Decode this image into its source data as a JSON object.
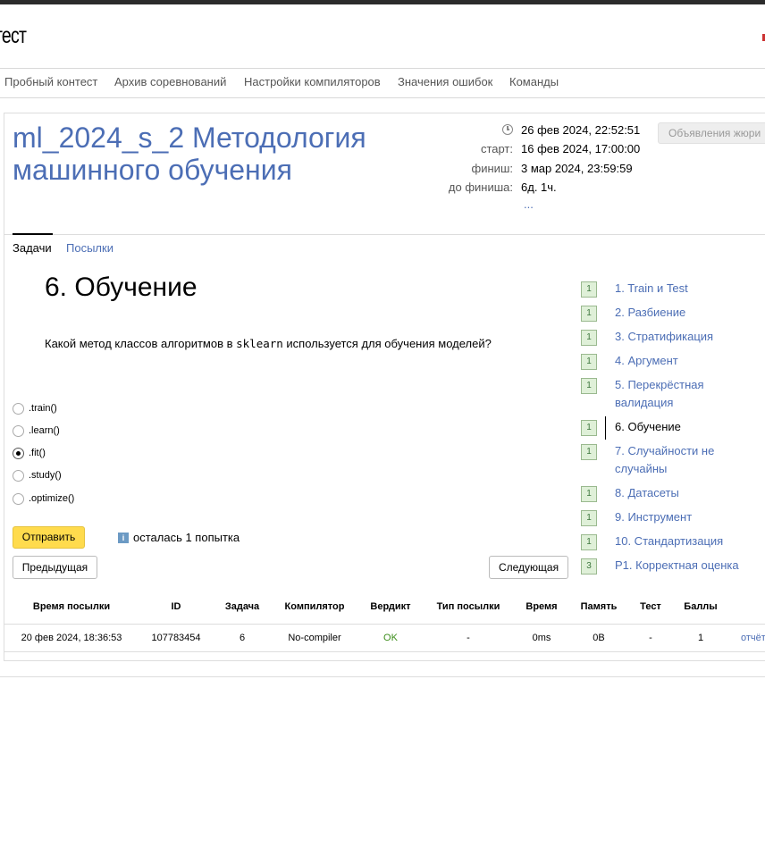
{
  "header": {
    "logo_text": "тест"
  },
  "nav": {
    "items": [
      "Пробный контест",
      "Архив соревнований",
      "Настройки компиляторов",
      "Значения ошибок",
      "Команды"
    ]
  },
  "contest": {
    "title": "ml_2024_s_2 Методология машинного обучения",
    "now": "26 фев 2024, 22:52:51",
    "start_label": "старт:",
    "start": "16 фев 2024, 17:00:00",
    "finish_label": "финиш:",
    "finish": "3 мар 2024, 23:59:59",
    "remaining_label": "до финиша:",
    "remaining": "6д. 1ч.",
    "more": "...",
    "jury_button": "Объявления жюри"
  },
  "tabs": {
    "problems": "Задачи",
    "submissions": "Посылки"
  },
  "problem": {
    "title": "6. Обучение",
    "question_before": "Какой метод классов алгоритмов в ",
    "question_code": "sklearn",
    "question_after": " используется для обучения моделей?",
    "options": [
      ".train()",
      ".learn()",
      ".fit()",
      ".study()",
      ".optimize()"
    ],
    "selected_index": 2,
    "submit_button": "Отправить",
    "info_icon": "i",
    "attempts_text": "осталась 1 попытка",
    "prev_button": "Предыдущая",
    "next_button": "Следующая"
  },
  "problem_list": [
    {
      "badge": "1",
      "label": "1. Train и Test"
    },
    {
      "badge": "1",
      "label": "2. Разбиение"
    },
    {
      "badge": "1",
      "label": "3. Стратификация"
    },
    {
      "badge": "1",
      "label": "4. Аргумент"
    },
    {
      "badge": "1",
      "label": "5. Перекрёстная валидация"
    },
    {
      "badge": "1",
      "label": "6. Обучение"
    },
    {
      "badge": "1",
      "label": "7. Случайности не случайны"
    },
    {
      "badge": "1",
      "label": "8. Датасеты"
    },
    {
      "badge": "1",
      "label": "9. Инструмент"
    },
    {
      "badge": "1",
      "label": "10. Стандартизация"
    },
    {
      "badge": "3",
      "label": "P1. Корректная оценка"
    }
  ],
  "submissions": {
    "headers": [
      "Время посылки",
      "ID",
      "Задача",
      "Компилятор",
      "Вердикт",
      "Тип посылки",
      "Время",
      "Память",
      "Тест",
      "Баллы"
    ],
    "row": [
      "20 фев 2024, 18:36:53",
      "107783454",
      "6",
      "No-compiler",
      "OK",
      "-",
      "0ms",
      "0B",
      "-",
      "1"
    ],
    "report_link": "отчёт"
  },
  "colors": {
    "link": "#4c6eb5",
    "submit": "#ffdb4d",
    "ok": "#3c8d1a",
    "badge_bg": "#dff0d8"
  }
}
